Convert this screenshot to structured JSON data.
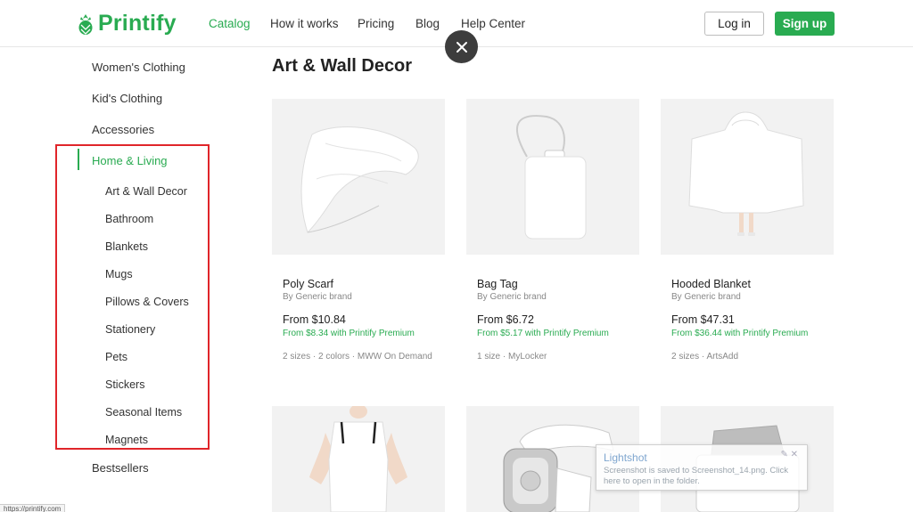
{
  "brand": {
    "name": "Printify",
    "color": "#29ab51",
    "icon": "pineapple-logo-icon"
  },
  "nav": {
    "items": [
      {
        "label": "Catalog",
        "active": true
      },
      {
        "label": "How it works",
        "active": false
      },
      {
        "label": "Pricing",
        "active": false
      },
      {
        "label": "Blog",
        "active": false
      },
      {
        "label": "Help Center",
        "active": false
      }
    ],
    "login_label": "Log in",
    "signup_label": "Sign up"
  },
  "overlay": {
    "close_icon": "close-icon"
  },
  "sidebar": {
    "items": [
      {
        "label": "Women's Clothing"
      },
      {
        "label": "Kid's Clothing"
      },
      {
        "label": "Accessories"
      },
      {
        "label": "Home & Living",
        "active": true
      },
      {
        "label": "Bestsellers"
      }
    ],
    "subitems": [
      "Art & Wall Decor",
      "Bathroom",
      "Blankets",
      "Mugs",
      "Pillows & Covers",
      "Stationery",
      "Pets",
      "Stickers",
      "Seasonal Items",
      "Magnets"
    ],
    "highlight_color": "#e0252a"
  },
  "main": {
    "title": "Art & Wall Decor",
    "products": [
      {
        "name": "Poly Scarf",
        "brand": "By Generic brand",
        "price": "From $10.84",
        "premium": "From $8.34 with Printify Premium",
        "meta": "2 sizes · 2 colors · MWW On Demand"
      },
      {
        "name": "Bag Tag",
        "brand": "By Generic brand",
        "price": "From $6.72",
        "premium": "From $5.17 with Printify Premium",
        "meta": "1 size · MyLocker"
      },
      {
        "name": "Hooded Blanket",
        "brand": "By Generic brand",
        "price": "From $47.31",
        "premium": "From $36.44 with Printify Premium",
        "meta": "2 sizes · ArtsAdd"
      },
      {
        "name": "",
        "image": "apron"
      },
      {
        "name": "",
        "image": "smartwatch-band"
      },
      {
        "name": "",
        "image": "laptop-sleeve"
      }
    ]
  },
  "toast": {
    "title": "Lightshot",
    "message": "Screenshot is saved to Screenshot_14.png. Click here to open in the folder."
  },
  "status_bar": {
    "url": "https://printify.com"
  }
}
